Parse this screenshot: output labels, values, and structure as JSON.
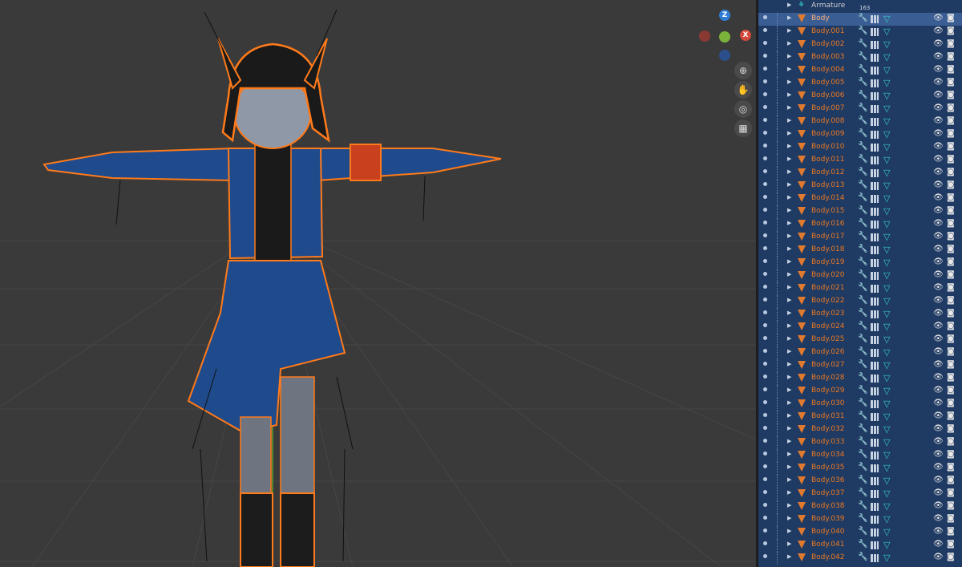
{
  "viewport": {
    "gizmo": {
      "z_label": "Z",
      "x_label": "X",
      "z_color": "#2f7cd6",
      "x_color": "#d2483b",
      "y_color": "#7bb33a"
    },
    "nav_tools": [
      {
        "name": "zoom-icon",
        "glyph": "⊕"
      },
      {
        "name": "pan-hand-icon",
        "glyph": "✋"
      },
      {
        "name": "camera-view-icon",
        "glyph": "🎥"
      },
      {
        "name": "perspective-grid-icon",
        "glyph": "▦"
      }
    ]
  },
  "outliner": {
    "armature": {
      "label": "Armature",
      "count": "163"
    },
    "active": {
      "label": "Body"
    },
    "items": [
      "Body.001",
      "Body.002",
      "Body.003",
      "Body.004",
      "Body.005",
      "Body.006",
      "Body.007",
      "Body.008",
      "Body.009",
      "Body.010",
      "Body.011",
      "Body.012",
      "Body.013",
      "Body.014",
      "Body.015",
      "Body.016",
      "Body.017",
      "Body.018",
      "Body.019",
      "Body.020",
      "Body.021",
      "Body.022",
      "Body.023",
      "Body.024",
      "Body.025",
      "Body.026",
      "Body.027",
      "Body.028",
      "Body.029",
      "Body.030",
      "Body.031",
      "Body.032",
      "Body.033",
      "Body.034",
      "Body.035",
      "Body.036",
      "Body.037",
      "Body.038",
      "Body.039",
      "Body.040",
      "Body.041",
      "Body.042"
    ],
    "colors": {
      "panel": "#1f3a63",
      "active_row": "#3a5d93",
      "object_text": "#ec7a22"
    }
  }
}
